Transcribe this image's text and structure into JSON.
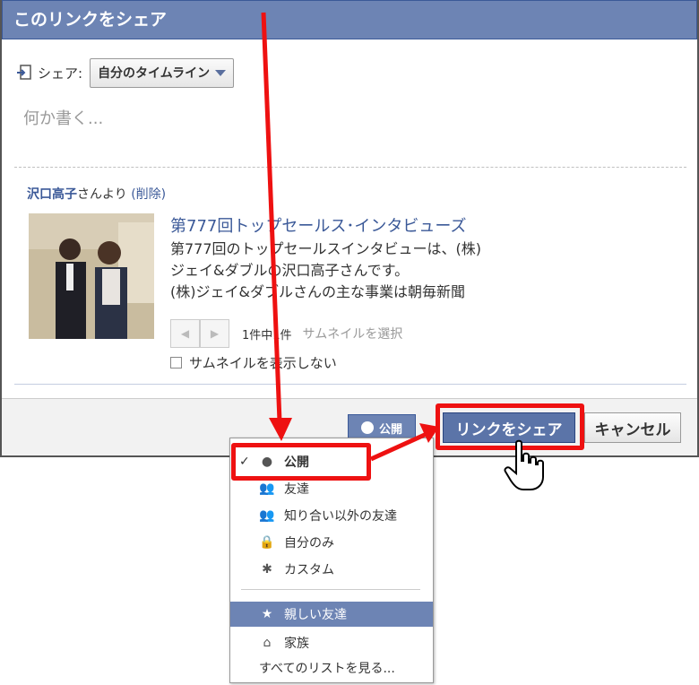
{
  "dialog": {
    "title": "このリンクをシェア",
    "share_label": "シェア:",
    "share_target": "自分のタイムライン",
    "compose_placeholder": "何か書く...",
    "from_name": "沢口高子",
    "from_suffix": "さんより",
    "delete_label": "(削除)",
    "link_title": "第777回トップセールス･インタビューズ",
    "description": [
      "第777回のトップセールスインタビューは、(株)",
      "ジェイ&ダブルの沢口高子さんです。",
      "(株)ジェイ&ダブルさんの主な事業は朝毎新聞"
    ],
    "thumb_counter": "1件中1件",
    "choose_thumbnail": "サムネイルを選択",
    "no_thumbnail": "サムネイルを表示しない"
  },
  "footer": {
    "privacy_label": "公開",
    "share_button": "リンクをシェア",
    "cancel_button": "キャンセル"
  },
  "privacy_menu": {
    "items": [
      {
        "label": "公開",
        "icon": "globe-icon",
        "checked": true
      },
      {
        "label": "友達",
        "icon": "friends-icon"
      },
      {
        "label": "知り合い以外の友達",
        "icon": "friends-except-icon"
      },
      {
        "label": "自分のみ",
        "icon": "lock-icon"
      },
      {
        "label": "カスタム",
        "icon": "gear-icon"
      },
      {
        "label": "親しい友達",
        "icon": "star-icon",
        "highlighted": true
      },
      {
        "label": "家族",
        "icon": "house-icon"
      },
      {
        "label": "すべてのリストを見る...",
        "icon": ""
      }
    ]
  },
  "colors": {
    "facebook_blue": "#6d84b4",
    "annotation_red": "#ee1111"
  }
}
